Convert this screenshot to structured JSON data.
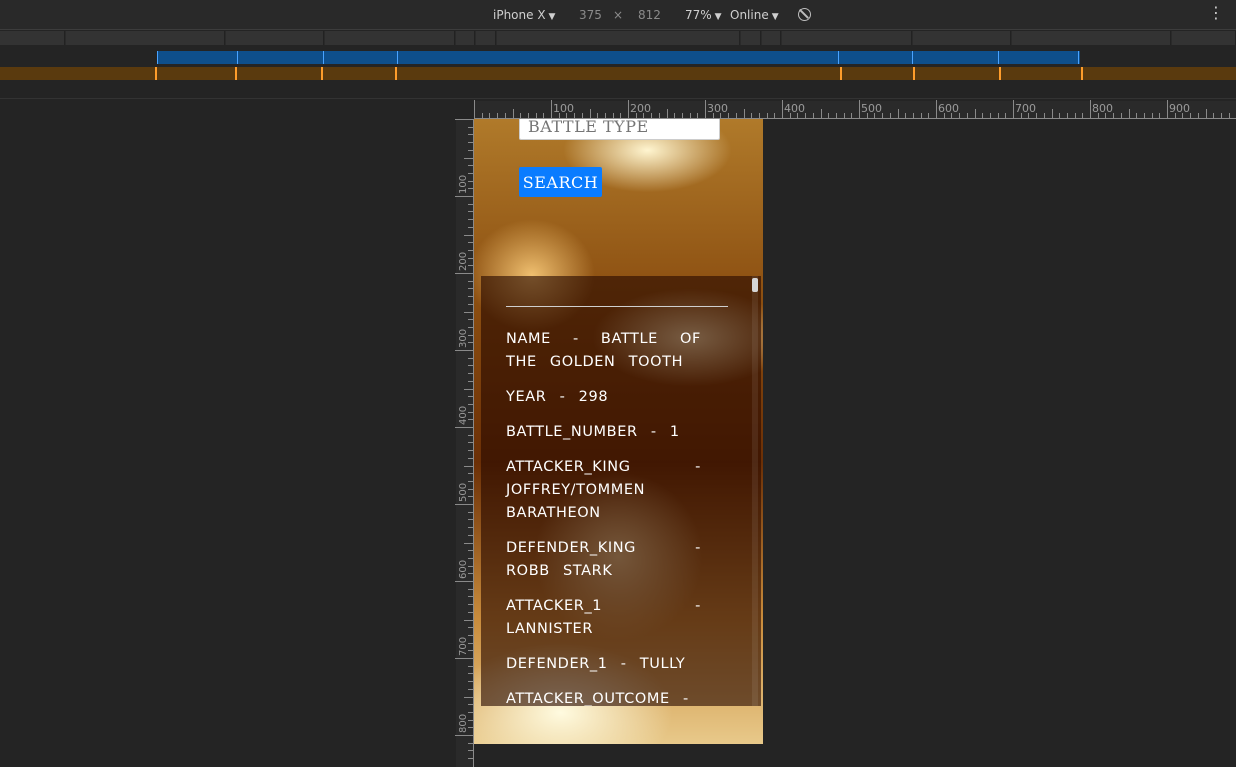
{
  "devtools": {
    "device": "iPhone X",
    "width": "375",
    "times": "×",
    "height": "812",
    "zoom": "77%",
    "network": "Online",
    "menu": "⋮",
    "ruler_top_labels": [
      "100",
      "200",
      "300",
      "400",
      "500",
      "600",
      "700",
      "800",
      "900"
    ],
    "ruler_left_labels": [
      "100",
      "200",
      "300",
      "400",
      "500",
      "600",
      "700",
      "800"
    ]
  },
  "page": {
    "battle_type_placeholder": "BATTLE TYPE",
    "search_label": "SEARCH",
    "fields": [
      "NAME - BATTLE OF THE GOLDEN TOOTH",
      "YEAR - 298",
      "BATTLE_NUMBER - 1",
      "ATTACKER_KING - JOFFREY/TOMMEN BARATHEON",
      "DEFENDER_KING - ROBB STARK",
      "ATTACKER_1 - LANNISTER",
      "DEFENDER_1 - TULLY",
      "ATTACKER_OUTCOME -"
    ]
  },
  "colors": {
    "accent": "#0a7cff",
    "media_query_blue": "#0e4f8c",
    "media_query_orange": "#5a3a0e"
  }
}
